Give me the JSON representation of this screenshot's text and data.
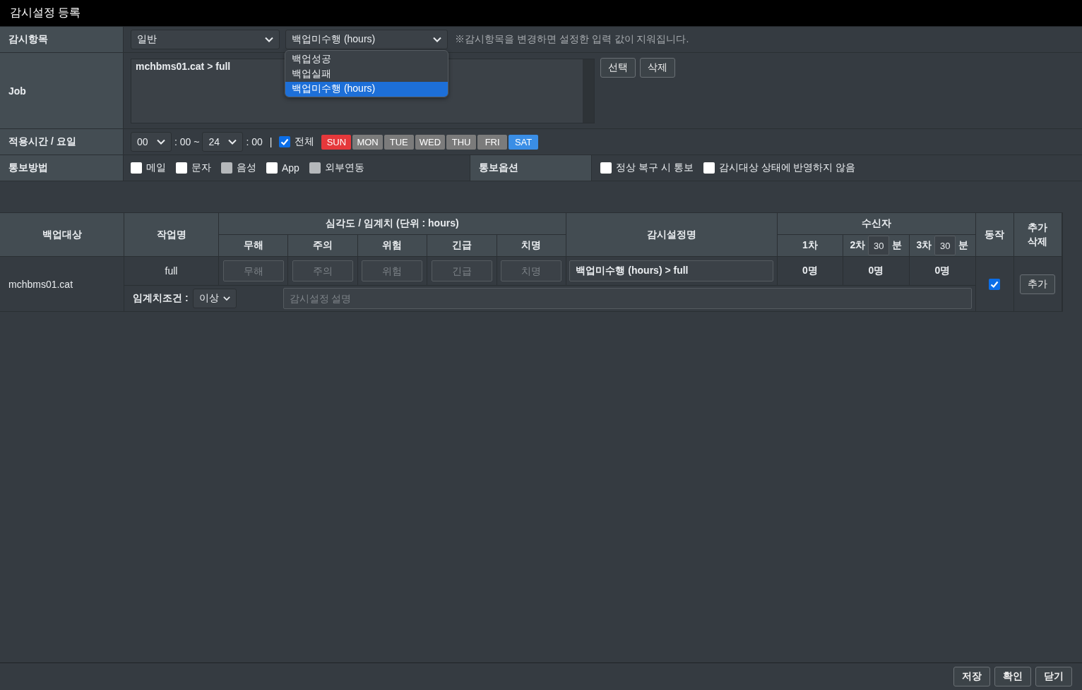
{
  "window": {
    "title": "감시설정 등록"
  },
  "form": {
    "monitor_item": {
      "label": "감시항목",
      "category": {
        "value": "일반"
      },
      "type": {
        "value": "백업미수행 (hours)",
        "expanded": true,
        "options": [
          {
            "label": "백업성공",
            "selected": false
          },
          {
            "label": "백업실패",
            "selected": false
          },
          {
            "label": "백업미수행 (hours)",
            "selected": true
          }
        ]
      },
      "note": "※감시항목을 변경하면 설정한 입력 값이 지워집니다."
    },
    "job": {
      "label": "Job",
      "value": "mchbms01.cat > full",
      "buttons": [
        "선택",
        "삭제"
      ]
    },
    "schedule": {
      "label": "적용시간 / 요일",
      "start_hour": "00",
      "start_suffix": ": 00 ~",
      "end_hour": "24",
      "end_suffix": ": 00",
      "separator": "|",
      "all_days": {
        "label": "전체",
        "checked": true
      },
      "days": [
        {
          "label": "SUN",
          "color": "#e5383b"
        },
        {
          "label": "MON",
          "color": "#7b7b7b"
        },
        {
          "label": "TUE",
          "color": "#7b7b7b"
        },
        {
          "label": "WED",
          "color": "#7b7b7b"
        },
        {
          "label": "THU",
          "color": "#7b7b7b"
        },
        {
          "label": "FRI",
          "color": "#7b7b7b"
        },
        {
          "label": "SAT",
          "color": "#3a8ee6"
        }
      ]
    },
    "notify": {
      "label": "통보방법",
      "methods": [
        {
          "label": "메일",
          "checked": false,
          "disabled": false
        },
        {
          "label": "문자",
          "checked": false,
          "disabled": false
        },
        {
          "label": "음성",
          "checked": false,
          "disabled": true
        },
        {
          "label": "App",
          "checked": false,
          "disabled": false
        },
        {
          "label": "외부연동",
          "checked": false,
          "disabled": true
        }
      ]
    },
    "notify_options": {
      "label": "통보옵션",
      "options": [
        {
          "label": "정상 복구 시 통보",
          "checked": false
        },
        {
          "label": "감시대상 상태에 반영하지 않음",
          "checked": false
        }
      ]
    }
  },
  "table": {
    "header": {
      "target": "백업대상",
      "job": "작업명",
      "severity": {
        "title": "심각도 / 임계치 (단위 : hours)",
        "levels": [
          "무해",
          "주의",
          "위험",
          "긴급",
          "치명"
        ]
      },
      "setting_name": "감시설정명",
      "recipients": {
        "title": "수신자",
        "tiers": [
          {
            "label": "1차"
          },
          {
            "label": "2차",
            "minutes": "30",
            "unit": "분"
          },
          {
            "label": "3차",
            "minutes": "30",
            "unit": "분"
          }
        ]
      },
      "action": "동작",
      "manage": [
        "추가",
        "삭제"
      ]
    },
    "rows": [
      {
        "target": "mchbms01.cat",
        "job": "full",
        "severity_placeholders": [
          "무해",
          "주의",
          "위험",
          "긴급",
          "치명"
        ],
        "setting_name": "백업미수행 (hours) > full",
        "recipients": [
          "0명",
          "0명",
          "0명"
        ],
        "enabled": true,
        "add_button": "추가",
        "condition_label": "임계치조건 :",
        "condition": "이상",
        "description_placeholder": "감시설정 설명"
      }
    ]
  },
  "footer": {
    "buttons": [
      "저장",
      "확인",
      "닫기"
    ]
  }
}
